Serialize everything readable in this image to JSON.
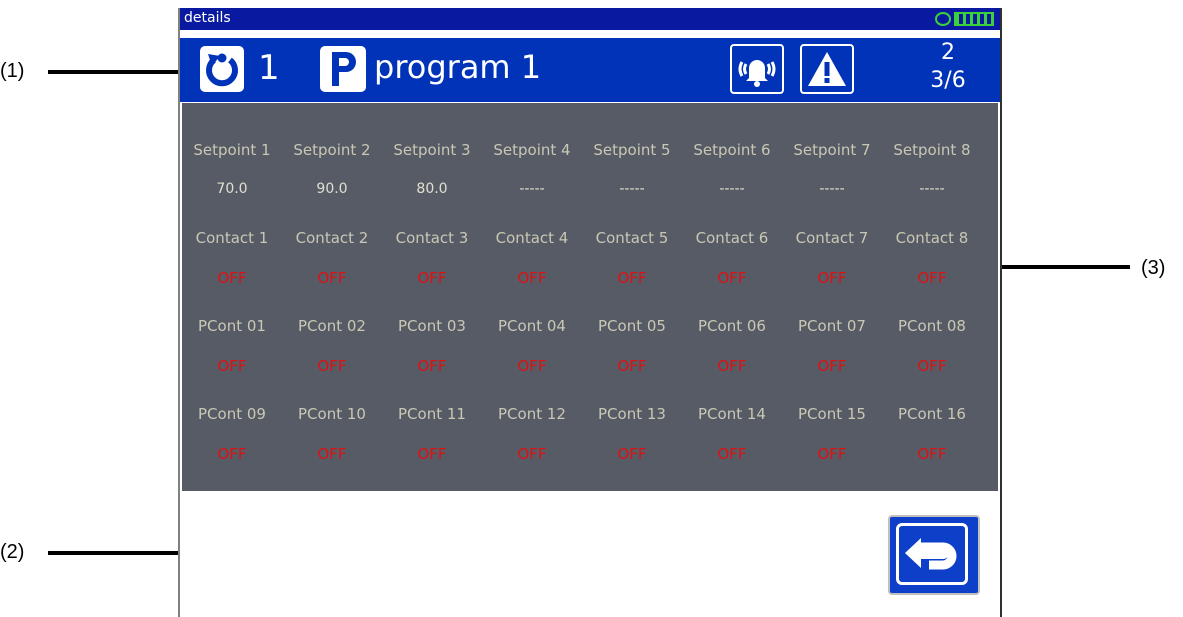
{
  "window": {
    "title": "details"
  },
  "callouts": {
    "c1": "(1)",
    "c2": "(2)",
    "c3": "(3)"
  },
  "header": {
    "channel_number": "1",
    "program_name": "program 1",
    "segment_line1": "2",
    "segment_line2": "3/6"
  },
  "setpoints": {
    "labels": [
      "Setpoint 1",
      "Setpoint 2",
      "Setpoint 3",
      "Setpoint 4",
      "Setpoint 5",
      "Setpoint 6",
      "Setpoint 7",
      "Setpoint 8"
    ],
    "values": [
      "70.0",
      "90.0",
      "80.0",
      "-----",
      "-----",
      "-----",
      "-----",
      "-----"
    ]
  },
  "contacts": {
    "labels": [
      "Contact 1",
      "Contact 2",
      "Contact 3",
      "Contact 4",
      "Contact 5",
      "Contact 6",
      "Contact 7",
      "Contact 8"
    ],
    "values": [
      "OFF",
      "OFF",
      "OFF",
      "OFF",
      "OFF",
      "OFF",
      "OFF",
      "OFF"
    ]
  },
  "pcont_a": {
    "labels": [
      "PCont 01",
      "PCont 02",
      "PCont 03",
      "PCont 04",
      "PCont 05",
      "PCont 06",
      "PCont 07",
      "PCont 08"
    ],
    "values": [
      "OFF",
      "OFF",
      "OFF",
      "OFF",
      "OFF",
      "OFF",
      "OFF",
      "OFF"
    ]
  },
  "pcont_b": {
    "labels": [
      "PCont 09",
      "PCont 10",
      "PCont 11",
      "PCont 12",
      "PCont 13",
      "PCont 14",
      "PCont 15",
      "PCont 16"
    ],
    "values": [
      "OFF",
      "OFF",
      "OFF",
      "OFF",
      "OFF",
      "OFF",
      "OFF",
      "OFF"
    ]
  },
  "colors": {
    "titlebar": "#0a1aa0",
    "header": "#0033b8",
    "panel": "#575b66",
    "off": "#e01010",
    "status_green": "#3ad13a"
  },
  "icons": [
    "program-cycle-icon",
    "program-p-icon",
    "alarm-bell-icon",
    "warning-icon",
    "return-arrow-icon",
    "run-status-icon",
    "io-status-icon"
  ]
}
